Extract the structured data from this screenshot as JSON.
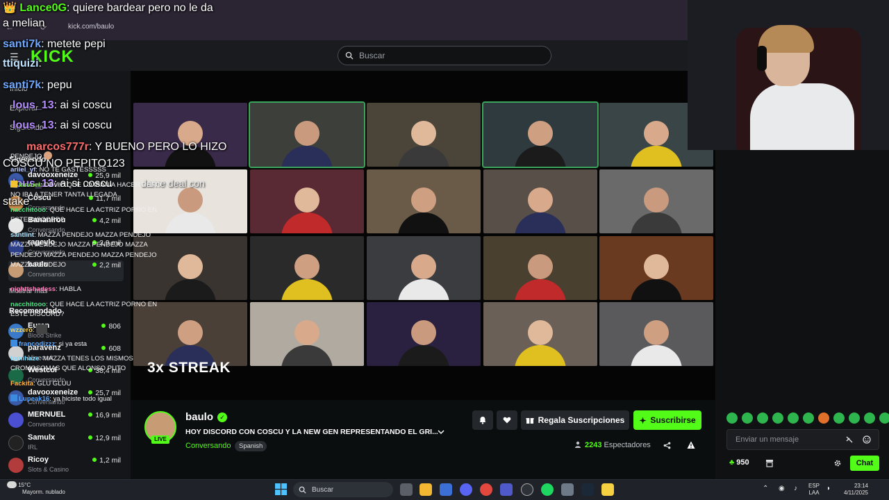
{
  "browser": {
    "url": "kick.com/baulo",
    "back_glyph": "←",
    "reload_glyph": "⟳"
  },
  "header": {
    "logo": "KICK",
    "menu_glyph": "☰",
    "search_placeholder": "Buscar"
  },
  "sidebar": {
    "nav": [
      "Inicio",
      "Explorar",
      "Siguiendo"
    ],
    "following_heading": "Siguiendo",
    "following": [
      {
        "name": "davooxeneize",
        "category": "Conversando",
        "viewers": "25,9 mil",
        "color": "#3a5aa8"
      },
      {
        "name": "Coscu",
        "category": "Conversando",
        "viewers": "11,7 mil",
        "color": "#c98a4a"
      },
      {
        "name": "Bananirou",
        "category": "Conversando",
        "viewers": "4,2 mil",
        "color": "#e6e6e6"
      },
      {
        "name": "rageylo",
        "category": "Conversando",
        "viewers": "2,9 mil",
        "color": "#2e3f8a"
      },
      {
        "name": "baulo",
        "category": "Conversando",
        "viewers": "2,2 mil",
        "color": "#c79b74"
      }
    ],
    "show_more": "Mostrar más",
    "recommended_heading": "Recomendado",
    "recommended": [
      {
        "name": "Euren",
        "category": "Blood Strike",
        "viewers": "806",
        "color": "#3b7ac9"
      },
      {
        "name": "paravenz",
        "category": "Minecraft",
        "viewers": "608",
        "color": "#d1d1d1"
      },
      {
        "name": "Westcol",
        "category": "Conversando",
        "viewers": "38,4 mil",
        "color": "#1b6a47"
      },
      {
        "name": "davooxeneize",
        "category": "Conversando",
        "viewers": "25,7 mil",
        "color": "#3a5aa8"
      },
      {
        "name": "MERNUEL",
        "category": "Conversando",
        "viewers": "16,9 mil",
        "color": "#4b4fd1"
      },
      {
        "name": "Samulx",
        "category": "IRL",
        "viewers": "12,9 mil",
        "color": "#222222"
      },
      {
        "name": "Ricoy",
        "category": "Slots & Casino",
        "viewers": "1,2 mil",
        "color": "#b23b3b"
      }
    ]
  },
  "overlay_chat": [
    {
      "user": "Lance0G",
      "text": ": quiere bardear pero no le da",
      "color": "#53fc18"
    },
    {
      "user": "",
      "text": "a melian",
      "color": "#ffffff"
    },
    {
      "user": "santi7k",
      "text": ": metete pepi",
      "color": "#6fa8ff"
    },
    {
      "user": "ttiquizi",
      "text": ":",
      "color": "#bfe3ff"
    },
    {
      "user": "santi7k",
      "text": ": pepu",
      "color": "#6fa8ff"
    },
    {
      "user": "lous_13",
      "text": ": ai si coscu",
      "color": "#b48cff"
    },
    {
      "user": "lous_13",
      "text": ": ai si coscu",
      "color": "#b48cff"
    },
    {
      "user": "marcos777r",
      "text": ": Y BUENO PERO LO HIZO",
      "color": "#ff6b6b"
    },
    {
      "user": "",
      "text": "COSCU NO PEPITO123",
      "color": "#ffffff"
    },
    {
      "user": "lous_13",
      "text": ": ai si coscu",
      "color": "#b48cff"
    },
    {
      "user": "",
      "text": "stake",
      "color": "#ffffff"
    }
  ],
  "stream_overlay": {
    "streak": "3x STREAK",
    "caption": "dame deal con"
  },
  "stream": {
    "channel": "baulo",
    "verified_glyph": "✓",
    "live": "LIVE",
    "title": "HOY DISCORD CON COSCU Y LA NEW GEN REPRESENTANDO EL GRI...",
    "category": "Conversando",
    "language": "Spanish",
    "gift_label": "Regala Suscripciones",
    "subscribe_label": "Suscribirse",
    "viewers": "2243",
    "viewers_label": "Espectadores"
  },
  "chat": {
    "messages": [
      {
        "user": "",
        "text": "PENDEJO",
        "color": "#ffffff"
      },
      {
        "user": "ariiel_yf",
        "text": ": NO TE GASTESSSSS",
        "color": "#b9c6ff"
      },
      {
        "user": "larvuel",
        "text": ": OBVIO QUE LO IBAN A HACER PERO NO IBA A TENER TANTA LLEGADA",
        "color": "#7ed957"
      },
      {
        "user": "nacchitooo",
        "text": ": QUE HACE LA ACTRIZ PORNO EN ESTE DISCORD?",
        "color": "#4be07e"
      },
      {
        "user": "santlint",
        "text": ": MAZZA PENDEJO MAZZA PENDEJO MAZZA PENDEJO MAZZA PENDEJO MAZZA PENDEJO MAZZA PENDEJO MAZZA PENDEJO MAZZA PENDEJO",
        "color": "#b7e9ff"
      },
      {
        "user": "nighttshadess",
        "text": ": HABLA",
        "color": "#ff7ab8"
      },
      {
        "user": "nacchitooo",
        "text": ": QUE HACE LA ACTRIZ PORNO EN ESTE DISCORD?",
        "color": "#4be07e"
      },
      {
        "user": "wzzero",
        "text": ":",
        "color": "#ffd84d"
      },
      {
        "user": "francodizzz",
        "text": ": si ya esta",
        "color": "#5ea8ff"
      },
      {
        "user": "tomihaze",
        "text": ": MAZZA TENES LOS MISMOS CROMOSOMAS QUE ALONSO PUTO",
        "color": "#7fdcff"
      },
      {
        "user": "Fackita",
        "text": ": GLU GLUU",
        "color": "#ffb347"
      },
      {
        "user": "Lupeak16",
        "text": ": ya hiciste todo igual",
        "color": "#4fa0ff"
      }
    ],
    "input_placeholder": "Enviar un mensaje",
    "points": "950",
    "send_label": "Chat"
  },
  "taskbar": {
    "temperature": "15°C",
    "weather": "Mayorm. nublado",
    "search_label": "Buscar",
    "lang_top": "ESP",
    "lang_bottom": "LAA",
    "time": "23:14",
    "date": "4/11/2025"
  }
}
